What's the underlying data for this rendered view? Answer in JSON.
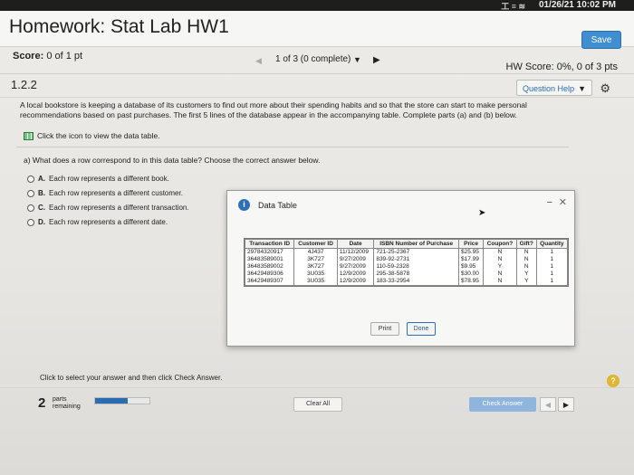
{
  "system": {
    "clock": "01/26/21 10:02 PM",
    "tray": "工 ≡ ≋"
  },
  "header": {
    "title": "Homework: Stat Lab HW1",
    "save_label": "Save"
  },
  "scorebar": {
    "score_label": "Score:",
    "score_value": "0 of 1 pt",
    "nav_count": "1 of 3 (0 complete)",
    "hw_score": "HW Score: 0%, 0 of 3 pts"
  },
  "question": {
    "number": "1.2.2",
    "help_label": "Question Help",
    "problem_text": "A local bookstore is keeping a database of its customers to find out more about their spending habits and so that the store can start to make personal recommendations based on past purchases. The first 5 lines of the database appear in the accompanying table. Complete parts (a) and (b) below.",
    "click_icon_text": "Click the icon to view the data table.",
    "part_a": "a) What does a row correspond to in this data table? Choose the correct answer below.",
    "options": [
      {
        "letter": "A.",
        "text": "Each row represents a different book."
      },
      {
        "letter": "B.",
        "text": "Each row represents a different customer."
      },
      {
        "letter": "C.",
        "text": "Each row represents a different transaction."
      },
      {
        "letter": "D.",
        "text": "Each row represents a different date."
      }
    ]
  },
  "modal": {
    "title": "Data Table",
    "columns": [
      "Transaction ID",
      "Customer ID",
      "Date",
      "ISBN Number of Purchase",
      "Price",
      "Coupon?",
      "Gift?",
      "Quantity"
    ],
    "rows": [
      [
        "29784320917",
        "4J437",
        "11/12/2009",
        "721-25-2367",
        "$25.95",
        "N",
        "N",
        "1"
      ],
      [
        "36483589001",
        "3K727",
        "9/27/2009",
        "839-92-2731",
        "$17.99",
        "N",
        "N",
        "1"
      ],
      [
        "36483589002",
        "3K727",
        "9/27/2009",
        "110-59-2328",
        "$9.95",
        "Y",
        "N",
        "1"
      ],
      [
        "36429489306",
        "3U035",
        "12/9/2009",
        "295-38-5878",
        "$30.00",
        "N",
        "Y",
        "1"
      ],
      [
        "36429489307",
        "3U035",
        "12/9/2009",
        "183-33-2954",
        "$78.95",
        "N",
        "Y",
        "1"
      ]
    ],
    "print_label": "Print",
    "done_label": "Done"
  },
  "footer": {
    "instruction": "Click to select your answer and then click Check Answer.",
    "parts_count": "2",
    "parts_label_1": "parts",
    "parts_label_2": "remaining",
    "progress": 0.6,
    "clear_label": "Clear All",
    "check_label": "Check Answer"
  }
}
